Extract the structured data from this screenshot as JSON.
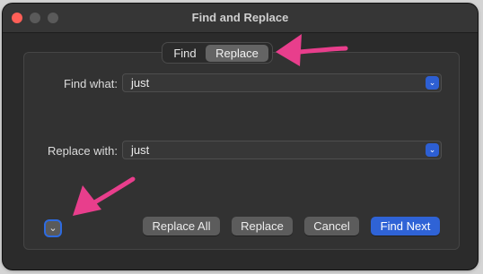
{
  "window": {
    "title": "Find and Replace"
  },
  "mode_tabs": [
    {
      "label": "Find",
      "selected": false
    },
    {
      "label": "Replace",
      "selected": true
    }
  ],
  "find": {
    "label": "Find what:",
    "value": "just"
  },
  "replace": {
    "label": "Replace with:",
    "value": "just"
  },
  "buttons": {
    "replace_all": "Replace All",
    "replace": "Replace",
    "cancel": "Cancel",
    "find_next": "Find Next"
  },
  "icons": {
    "dropdown": "chevron-down-icon",
    "disclosure": "chevron-down-icon"
  },
  "colors": {
    "accent": "#2f63d6",
    "annotation_arrow": "#e83e8c"
  }
}
